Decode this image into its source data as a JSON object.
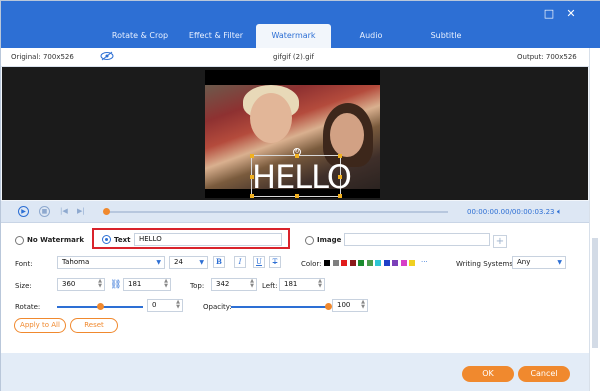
{
  "tabs": [
    "Rotate & Crop",
    "Effect & Filter",
    "Watermark",
    "Audio",
    "Subtitle"
  ],
  "window": {
    "maximize": "□",
    "close": "✕"
  },
  "infobar": {
    "original": "Original: 700x526",
    "filename": "gifgif (2).gif",
    "output": "Output: 700x526"
  },
  "preview": {
    "watermark_text": "HELLO"
  },
  "playback": {
    "time": "00:00:00.00/00:00:03.23",
    "progress": 0.0
  },
  "watermark": {
    "no_watermark_label": "No Watermark",
    "text_label": "Text",
    "text_value": "HELLO",
    "image_label": "Image",
    "image_value": "",
    "mode": "text"
  },
  "font": {
    "label": "Font:",
    "family": "Tahoma",
    "size": "24",
    "bold": "B",
    "italic": "I",
    "underline": "U",
    "strike": "T"
  },
  "color": {
    "label": "Color:",
    "swatches": [
      "#000000",
      "#7f7f7f",
      "#e11b1b",
      "#8b1a1a",
      "#1a8b2e",
      "#4a9a4a",
      "#2dc6d4",
      "#1e40c8",
      "#7b3fb8",
      "#d63fc8",
      "#f0d020"
    ],
    "more": "···"
  },
  "writing": {
    "label": "Writing Systems:",
    "value": "Any"
  },
  "size": {
    "label": "Size:",
    "w": "360",
    "h": "181"
  },
  "position": {
    "top_label": "Top:",
    "top": "342",
    "left_label": "Left:",
    "left": "181"
  },
  "rotate": {
    "label": "Rotate:",
    "value": "0",
    "level": 0.5
  },
  "opacity": {
    "label": "Opacity:",
    "value": "100",
    "level": 1.0
  },
  "buttons": {
    "apply_all": "Apply to All",
    "reset": "Reset",
    "ok": "OK",
    "cancel": "Cancel"
  },
  "icons": {
    "eye": "eye-off-icon",
    "link": "link-icon",
    "play": "play-icon",
    "stop": "stop-icon",
    "prev": "prev-icon",
    "next": "next-icon",
    "volume": "volume-icon"
  }
}
